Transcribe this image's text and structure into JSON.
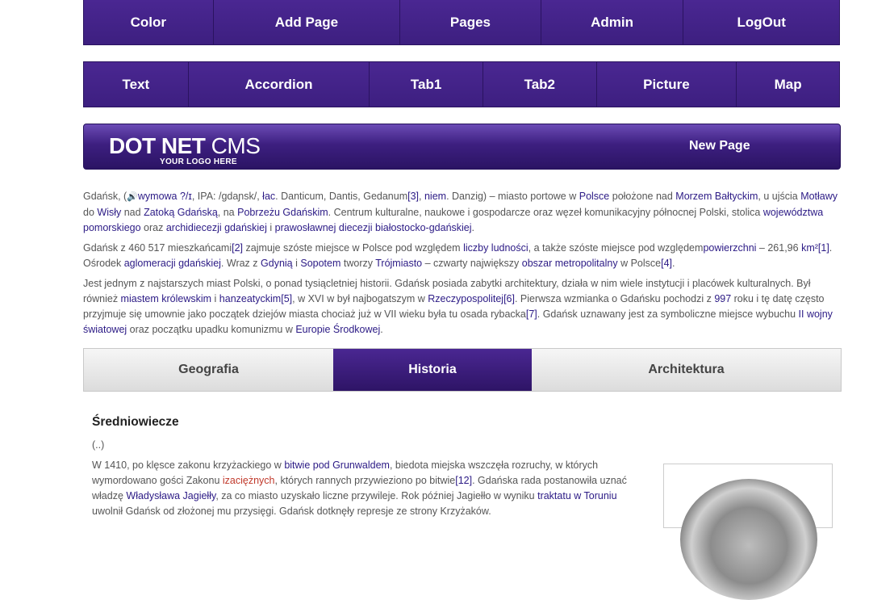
{
  "nav_primary": [
    "Color",
    "Add Page",
    "Pages",
    "Admin",
    "LogOut"
  ],
  "nav_secondary": [
    "Text",
    "Accordion",
    "Tab1",
    "Tab2",
    "Picture",
    "Map"
  ],
  "banner": {
    "logo_main_bold": "DOT NET",
    "logo_main_light": " CMS",
    "logo_sub": "YOUR LOGO HERE",
    "new_page": "New Page"
  },
  "article": {
    "p1": [
      {
        "t": "Gdańsk, ("
      },
      {
        "t": "🔊",
        "icon": "speaker-icon"
      },
      {
        "t": "wymowa ?/ɪ",
        "link": true
      },
      {
        "t": ", IPA: /gdaɲsk/, "
      },
      {
        "t": "łac",
        "link": true
      },
      {
        "t": ". Danticum, Dantis, Gedanum"
      },
      {
        "t": "[3]",
        "link": true
      },
      {
        "t": ", "
      },
      {
        "t": "niem",
        "link": true
      },
      {
        "t": ". Danzig) – miasto portowe w "
      },
      {
        "t": "Polsce",
        "link": true
      },
      {
        "t": " położone nad "
      },
      {
        "t": "Morzem Bałtyckim",
        "link": true
      },
      {
        "t": ", u ujścia "
      },
      {
        "t": "Motławy",
        "link": true
      },
      {
        "t": " do "
      },
      {
        "t": "Wisły",
        "link": true
      },
      {
        "t": " nad "
      },
      {
        "t": "Zatoką Gdańską",
        "link": true
      },
      {
        "t": ", na "
      },
      {
        "t": "Pobrzeżu Gdańskim",
        "link": true
      },
      {
        "t": ". Centrum kulturalne, naukowe i gospodarcze oraz węzeł komunikacyjny północnej Polski, stolica "
      },
      {
        "t": "województwa pomorskiego",
        "link": true
      },
      {
        "t": " oraz "
      },
      {
        "t": "archidiecezji gdańskiej",
        "link": true
      },
      {
        "t": " i "
      },
      {
        "t": "prawosławnej diecezji białostocko-gdańskiej",
        "link": true
      },
      {
        "t": "."
      }
    ],
    "p2": [
      {
        "t": "Gdańsk z 460 517 mieszkańcami"
      },
      {
        "t": "[2]",
        "link": true
      },
      {
        "t": " zajmuje szóste miejsce w Polsce pod względem "
      },
      {
        "t": "liczby ludności",
        "link": true
      },
      {
        "t": ", a także szóste miejsce pod względem"
      },
      {
        "t": "powierzchni",
        "link": true
      },
      {
        "t": " – 261,96 "
      },
      {
        "t": "km²",
        "link": true
      },
      {
        "t": "[1]",
        "link": true
      },
      {
        "t": ". Ośrodek "
      },
      {
        "t": "aglomeracji gdańskiej",
        "link": true
      },
      {
        "t": ". Wraz z "
      },
      {
        "t": "Gdynią",
        "link": true
      },
      {
        "t": " i "
      },
      {
        "t": "Sopotem",
        "link": true
      },
      {
        "t": " tworzy "
      },
      {
        "t": "Trójmiasto",
        "link": true
      },
      {
        "t": " – czwarty największy "
      },
      {
        "t": "obszar metropolitalny",
        "link": true
      },
      {
        "t": " w Polsce"
      },
      {
        "t": "[4]",
        "link": true
      },
      {
        "t": "."
      }
    ],
    "p3": [
      {
        "t": "Jest jednym z najstarszych miast Polski, o ponad tysiącletniej historii. Gdańsk posiada zabytki architektury, działa w nim wiele instytucji i placówek kulturalnych. Był również "
      },
      {
        "t": "miastem królewskim",
        "link": true
      },
      {
        "t": " i "
      },
      {
        "t": "hanzeatyckim",
        "link": true
      },
      {
        "t": "[5]",
        "link": true
      },
      {
        "t": ", w XVI w był najbogatszym w "
      },
      {
        "t": "Rzeczypospolitej",
        "link": true
      },
      {
        "t": "[6]",
        "link": true
      },
      {
        "t": ". Pierwsza wzmianka o Gdańsku pochodzi z "
      },
      {
        "t": "997",
        "link": true
      },
      {
        "t": " roku i tę datę często przyjmuje się umownie jako początek dziejów miasta chociaż już w VII wieku była tu osada rybacka"
      },
      {
        "t": "[7]",
        "link": true
      },
      {
        "t": ". Gdańsk uznawany jest za symboliczne miejsce wybuchu "
      },
      {
        "t": "II wojny światowej",
        "link": true
      },
      {
        "t": " oraz początku upadku komunizmu w "
      },
      {
        "t": "Europie Środkowej",
        "link": true
      },
      {
        "t": "."
      }
    ]
  },
  "tabs": [
    {
      "label": "Geografia",
      "active": false
    },
    {
      "label": "Historia",
      "active": true
    },
    {
      "label": "Architektura",
      "active": false
    }
  ],
  "section": {
    "title": "Średniowiecze",
    "ellipsis": "(..)",
    "body": [
      {
        "t": "W 1410, po klęsce zakonu krzyżackiego w "
      },
      {
        "t": "bitwie pod Grunwaldem",
        "link": true
      },
      {
        "t": ", biedota miejska wszczęła rozruchy, w których wymordowano gości Zakonu "
      },
      {
        "t": "izaciężnych",
        "link": true,
        "alt": true
      },
      {
        "t": ", których rannych przywieziono po bitwie"
      },
      {
        "t": "[12]",
        "link": true
      },
      {
        "t": ". Gdańska rada postanowiła uznać władzę "
      },
      {
        "t": "Władysława Jagiełły",
        "link": true
      },
      {
        "t": ", za co miasto uzyskało liczne przywileje. Rok później Jagiełło w wyniku "
      },
      {
        "t": "traktatu w Toruniu",
        "link": true
      },
      {
        "t": " uwolnił Gdańsk od złożonej mu przysięgi. Gdańsk dotknęły represje ze strony Krzyżaków."
      }
    ]
  }
}
